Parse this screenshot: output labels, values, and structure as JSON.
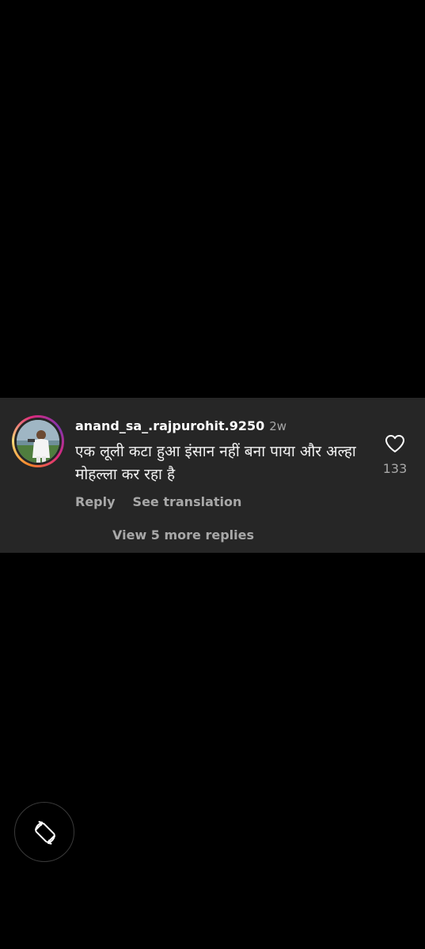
{
  "comment": {
    "username": "anand_sa_.rajpurohit.9250",
    "time_ago": "2w",
    "text": "एक लूली कटा हुआ इंसान नहीं बना पाया और अल्हा मोहल्ला कर रहा है",
    "like_count": "133",
    "actions": {
      "reply": "Reply",
      "see_translation": "See translation"
    },
    "view_replies": "View 5 more replies",
    "icons": {
      "like": "heart-outline-icon",
      "avatar": "user-avatar"
    }
  },
  "system": {
    "rotate_icon": "screen-rotate-icon"
  },
  "colors": {
    "background": "#000000",
    "card_background": "#262626",
    "primary_text": "#ffffff",
    "secondary_text": "#a8a8a8"
  }
}
